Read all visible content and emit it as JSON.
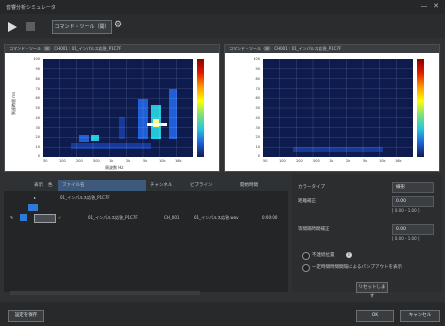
{
  "window": {
    "title": "音響分析シミュレータ",
    "controls": [
      "—",
      "✕"
    ]
  },
  "toolbar": {
    "button_label": "コマンド・ツール（開）",
    "gear_label": "⚙"
  },
  "panels": [
    {
      "title": "コマンド・ツール（開）    CH001 : 01_インパルス応答_P1C7F",
      "yaxis_label": "到達時間 ms",
      "xaxis_label": "周波数 Hz",
      "yticks": [
        "100",
        "90",
        "80",
        "70",
        "60",
        "50",
        "40",
        "30",
        "20",
        "10",
        "0"
      ],
      "xticks": [
        "50",
        "100",
        "200",
        "500",
        "1k",
        "2k",
        "5k",
        "10k",
        "16k"
      ]
    },
    {
      "title": "コマンド・ツール（開）    CH001 : 01_インパルス応答_P1C7F",
      "yaxis_label": "",
      "xaxis_label": "",
      "yticks": [
        "100",
        "90",
        "80",
        "70",
        "60",
        "50",
        "40",
        "30",
        "20",
        "10",
        "0"
      ],
      "xticks": [
        "50",
        "100",
        "200",
        "500",
        "1k",
        "2k",
        "5k",
        "10k",
        "16k"
      ]
    }
  ],
  "table": {
    "headers": [
      "表示",
      "色",
      "ファイル名",
      "チャンネル",
      "ビブライン",
      "開始時間"
    ],
    "group_label": "01_インパルス応答_P1C7F",
    "rows": [
      {
        "name": "01_インパルス応答_P1C7F",
        "ch": "CH_001",
        "vib": "01_インパルス応答.wav",
        "start": "0:00:00"
      }
    ]
  },
  "props": {
    "type_label": "カラータイプ",
    "type_value": "線形",
    "gain_label": "距離補正",
    "gain_value": "0.00",
    "gain_range": "[ 0.00 - 1.00 ]",
    "interval_label": "等間隔時間補正",
    "interval_value": "0.00",
    "interval_range": "[ 0.00 - 1.00 ]",
    "opt1_label": "不連続位置",
    "opt2_label": "一定時間時間間隔によるパンプアウトを表示",
    "reset_label": "リセットします"
  },
  "bottom": {
    "left_label": "設定を保存",
    "ok_label": "OK",
    "cancel_label": "キャンセル"
  }
}
